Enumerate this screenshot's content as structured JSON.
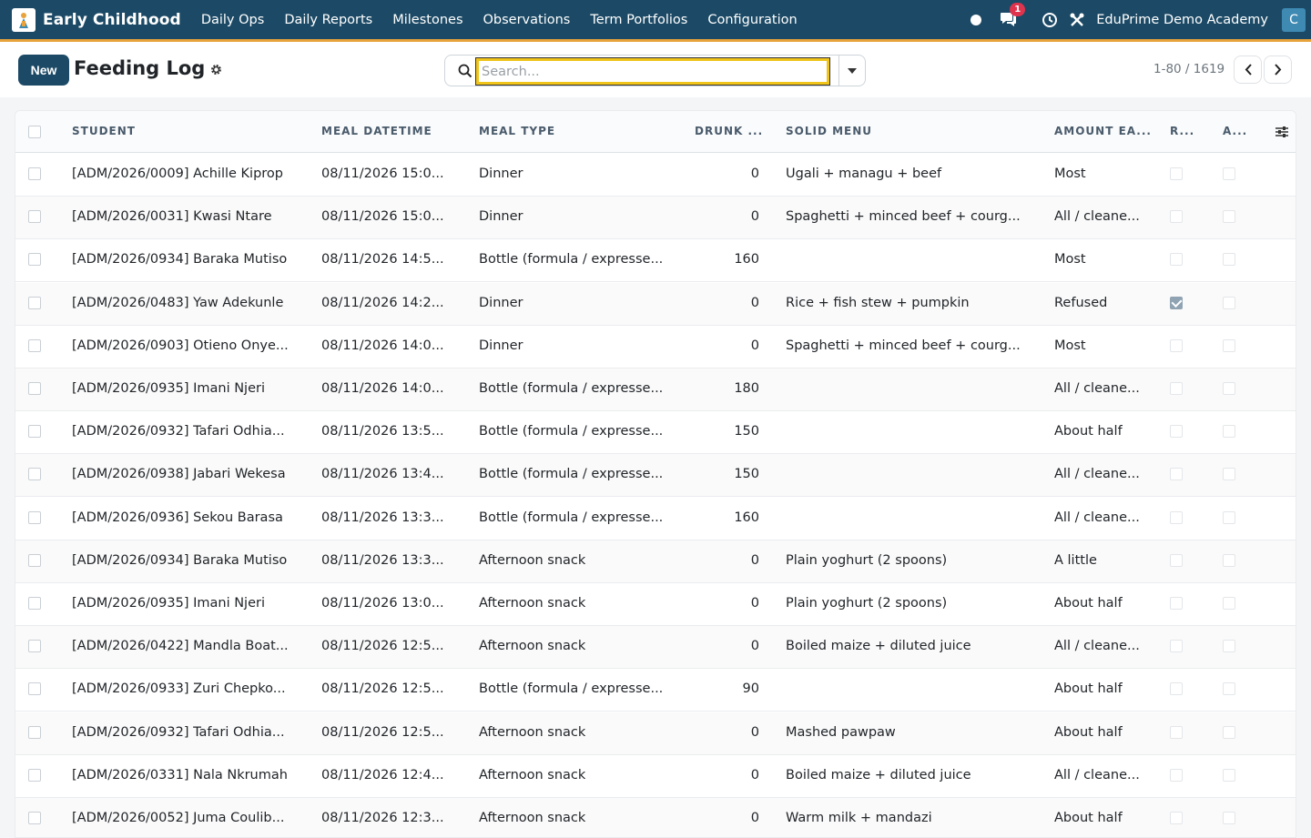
{
  "navbar": {
    "app_name": "Early Childhood",
    "menu": [
      "Daily Ops",
      "Daily Reports",
      "Milestones",
      "Observations",
      "Term Portfolios",
      "Configuration"
    ],
    "chat_badge": "1",
    "company": "EduPrime Demo Academy",
    "user_initial": "C",
    "colors": {
      "bar": "#1c4a66",
      "accent_line": "#e8a33d",
      "badge": "#e0334d"
    }
  },
  "control": {
    "new_label": "New",
    "title": "Feeding Log",
    "search_placeholder": "Search...",
    "pager": "1-80 / 1619"
  },
  "table": {
    "headers": [
      "STUDENT",
      "MEAL DATETIME",
      "MEAL TYPE",
      "DRUNK ...",
      "SOLID MENU",
      "AMOUNT EA...",
      "R...",
      "A..."
    ],
    "rows": [
      {
        "student": "[ADM/2026/0009] Achille Kiprop",
        "datetime": "08/11/2026 15:0...",
        "meal_type": "Dinner",
        "drunk": "0",
        "solid_menu": "Ugali + managu + beef",
        "amount": "Most",
        "r": false,
        "a": false
      },
      {
        "student": "[ADM/2026/0031] Kwasi Ntare",
        "datetime": "08/11/2026 15:0...",
        "meal_type": "Dinner",
        "drunk": "0",
        "solid_menu": "Spaghetti + minced beef + courg...",
        "amount": "All / cleane...",
        "r": false,
        "a": false
      },
      {
        "student": "[ADM/2026/0934] Baraka Mutiso",
        "datetime": "08/11/2026 14:5...",
        "meal_type": "Bottle (formula / expresse...",
        "drunk": "160",
        "solid_menu": "",
        "amount": "Most",
        "r": false,
        "a": false
      },
      {
        "student": "[ADM/2026/0483] Yaw Adekunle",
        "datetime": "08/11/2026 14:2...",
        "meal_type": "Dinner",
        "drunk": "0",
        "solid_menu": "Rice + fish stew + pumpkin",
        "amount": "Refused",
        "r": true,
        "a": false
      },
      {
        "student": "[ADM/2026/0903] Otieno Onye...",
        "datetime": "08/11/2026 14:0...",
        "meal_type": "Dinner",
        "drunk": "0",
        "solid_menu": "Spaghetti + minced beef + courg...",
        "amount": "Most",
        "r": false,
        "a": false
      },
      {
        "student": "[ADM/2026/0935] Imani Njeri",
        "datetime": "08/11/2026 14:0...",
        "meal_type": "Bottle (formula / expresse...",
        "drunk": "180",
        "solid_menu": "",
        "amount": "All / cleane...",
        "r": false,
        "a": false
      },
      {
        "student": "[ADM/2026/0932] Tafari Odhia...",
        "datetime": "08/11/2026 13:5...",
        "meal_type": "Bottle (formula / expresse...",
        "drunk": "150",
        "solid_menu": "",
        "amount": "About half",
        "r": false,
        "a": false
      },
      {
        "student": "[ADM/2026/0938] Jabari Wekesa",
        "datetime": "08/11/2026 13:4...",
        "meal_type": "Bottle (formula / expresse...",
        "drunk": "150",
        "solid_menu": "",
        "amount": "All / cleane...",
        "r": false,
        "a": false
      },
      {
        "student": "[ADM/2026/0936] Sekou Barasa",
        "datetime": "08/11/2026 13:3...",
        "meal_type": "Bottle (formula / expresse...",
        "drunk": "160",
        "solid_menu": "",
        "amount": "All / cleane...",
        "r": false,
        "a": false
      },
      {
        "student": "[ADM/2026/0934] Baraka Mutiso",
        "datetime": "08/11/2026 13:3...",
        "meal_type": "Afternoon snack",
        "drunk": "0",
        "solid_menu": "Plain yoghurt (2 spoons)",
        "amount": "A little",
        "r": false,
        "a": false
      },
      {
        "student": "[ADM/2026/0935] Imani Njeri",
        "datetime": "08/11/2026 13:0...",
        "meal_type": "Afternoon snack",
        "drunk": "0",
        "solid_menu": "Plain yoghurt (2 spoons)",
        "amount": "About half",
        "r": false,
        "a": false
      },
      {
        "student": "[ADM/2026/0422] Mandla Boat...",
        "datetime": "08/11/2026 12:5...",
        "meal_type": "Afternoon snack",
        "drunk": "0",
        "solid_menu": "Boiled maize + diluted juice",
        "amount": "All / cleane...",
        "r": false,
        "a": false
      },
      {
        "student": "[ADM/2026/0933] Zuri Chepko...",
        "datetime": "08/11/2026 12:5...",
        "meal_type": "Bottle (formula / expresse...",
        "drunk": "90",
        "solid_menu": "",
        "amount": "About half",
        "r": false,
        "a": false
      },
      {
        "student": "[ADM/2026/0932] Tafari Odhia...",
        "datetime": "08/11/2026 12:5...",
        "meal_type": "Afternoon snack",
        "drunk": "0",
        "solid_menu": "Mashed pawpaw",
        "amount": "About half",
        "r": false,
        "a": false
      },
      {
        "student": "[ADM/2026/0331] Nala Nkrumah",
        "datetime": "08/11/2026 12:4...",
        "meal_type": "Afternoon snack",
        "drunk": "0",
        "solid_menu": "Boiled maize + diluted juice",
        "amount": "All / cleane...",
        "r": false,
        "a": false
      },
      {
        "student": "[ADM/2026/0052] Juma Coulib...",
        "datetime": "08/11/2026 12:3...",
        "meal_type": "Afternoon snack",
        "drunk": "0",
        "solid_menu": "Warm milk + mandazi",
        "amount": "About half",
        "r": false,
        "a": false
      }
    ]
  }
}
